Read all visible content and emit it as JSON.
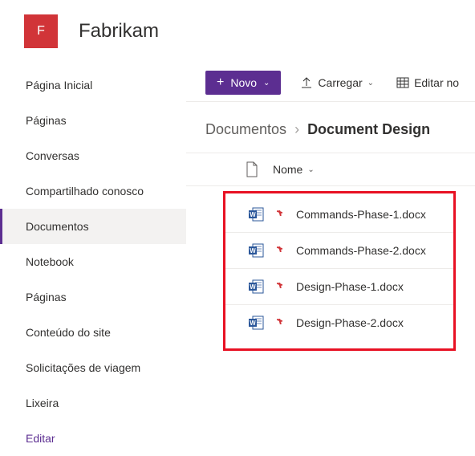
{
  "header": {
    "logo_letter": "F",
    "site_title": "Fabrikam"
  },
  "sidebar": {
    "items": [
      {
        "label": "Página Inicial"
      },
      {
        "label": "Páginas"
      },
      {
        "label": "Conversas"
      },
      {
        "label": "Compartilhado conosco"
      },
      {
        "label": "Documentos"
      },
      {
        "label": "Notebook"
      },
      {
        "label": "Páginas"
      },
      {
        "label": "Conteúdo do site"
      },
      {
        "label": "Solicitações de viagem"
      },
      {
        "label": "Lixeira"
      }
    ],
    "edit_label": "Editar"
  },
  "toolbar": {
    "new_label": "Novo",
    "upload_label": "Carregar",
    "edit_label": "Editar no"
  },
  "breadcrumb": {
    "root": "Documentos",
    "leaf": "Document Design"
  },
  "columns": {
    "name": "Nome"
  },
  "files": [
    {
      "name": "Commands-Phase-1.docx"
    },
    {
      "name": "Commands-Phase-2.docx"
    },
    {
      "name": "Design-Phase-1.docx"
    },
    {
      "name": "Design-Phase-2.docx"
    }
  ]
}
